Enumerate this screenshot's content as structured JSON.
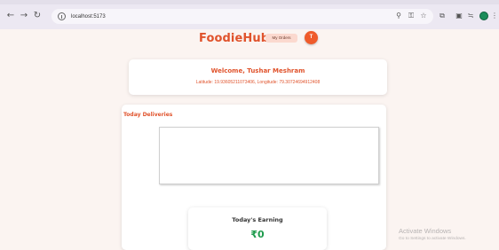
{
  "browser": {
    "url": "localhost:5173",
    "icons": [
      "arrow-back-icon",
      "arrow-forward-icon",
      "reload-icon",
      "site-info-icon",
      "location-icon",
      "key-icon",
      "star-icon",
      "extensions-icon",
      "tab-search-icon",
      "translate-icon",
      "profile-icon",
      "menu-icon"
    ],
    "profile_color": "#1a8c5a"
  },
  "header": {
    "brand": "FoodieHub",
    "orders_label": "My Orders",
    "avatar_initial": "T",
    "accent_color": "#e0532c"
  },
  "welcome": {
    "title": "Welcome, Tushar Meshram",
    "coords": "Latitude: 19.93605211073406, Longitude: 79.30724694912408"
  },
  "deliveries": {
    "title": "Today Deliveries"
  },
  "earning": {
    "label": "Today's Earning",
    "value": "₹0",
    "value_color": "#1e9b4c"
  },
  "watermark": {
    "title": "Activate Windows",
    "subtitle": "Go to Settings to activate Windows."
  }
}
